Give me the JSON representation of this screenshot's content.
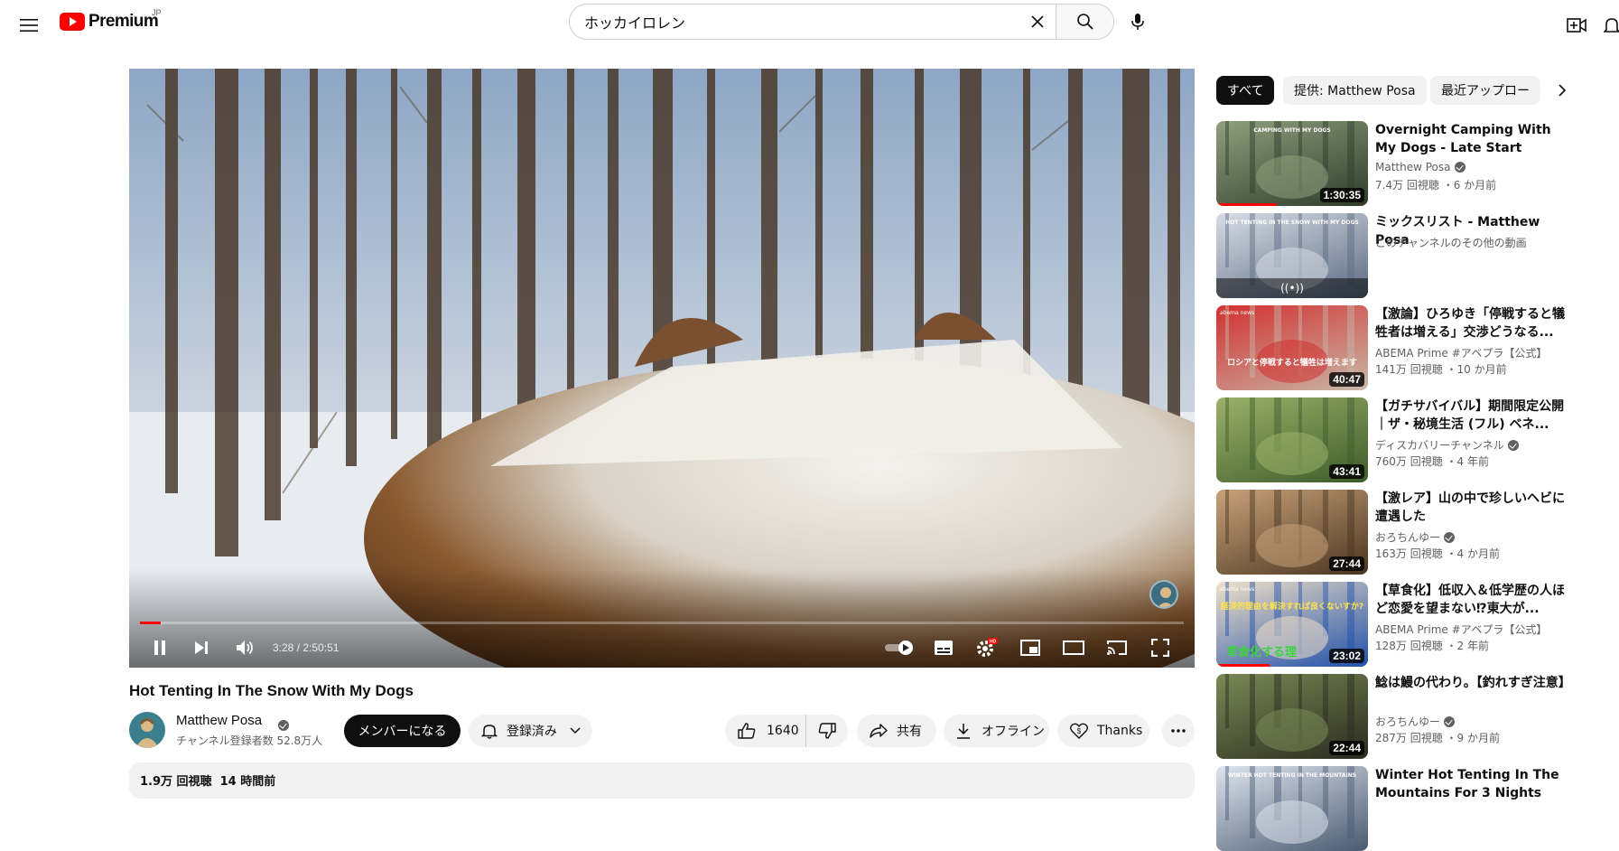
{
  "header": {
    "logo_text": "Premium",
    "region": "JP",
    "search_value": "ホッカイロレン"
  },
  "player": {
    "time_current": "3:28",
    "time_separator": " / ",
    "time_total": "2:50:51",
    "progress_played": 0.02,
    "progress_loaded": 0.021,
    "hd_badge": "HD"
  },
  "video": {
    "title": "Hot Tenting In The Snow With My Dogs",
    "channel": "Matthew Posa",
    "subscribers": "チャンネル登録者数 52.8万人",
    "join_label": "メンバーになる",
    "subscribed_label": "登録済み",
    "likes": "1640",
    "share_label": "共有",
    "offline_label": "オフライン",
    "thanks_label": "Thanks",
    "views_and_date": "1.9万 回視聴  14 時間前"
  },
  "sidebar": {
    "chips": [
      "すべて",
      "提供: Matthew Posa",
      "最近アップロー"
    ],
    "recommendations": [
      {
        "title": "Overnight Camping With My Dogs - Late Start Enabled",
        "channel": "Matthew Posa",
        "verified": true,
        "meta": "7.4万 回視聴 ・6 か月前",
        "duration": "1:30:35",
        "watched": 0.4,
        "thumb_text": "CAMPING WITH MY DOGS",
        "colors": [
          "#2f3b2a",
          "#8fa07e"
        ]
      },
      {
        "title": "ミックスリスト - Matthew Posa",
        "channel": "このチャンネルのその他の動画",
        "verified": false,
        "meta": "",
        "duration": "",
        "watched": 0,
        "thumb_text": "HOT TENTING IN THE SNOW WITH MY DOGS",
        "mix_symbol": "((•))",
        "colors": [
          "#5a6a80",
          "#d8dde6"
        ]
      },
      {
        "title": "【激論】ひろゆき「停戦すると犠牲者は増える」交渉どうなる...",
        "channel": "ABEMA Prime #アベプラ【公式】",
        "verified": false,
        "meta": "141万 回視聴 ・10 か月前",
        "duration": "40:47",
        "watched": 0,
        "thumb_text": "ロシアと停戦すると犠牲は増えます",
        "thumb_label": "abema news",
        "colors": [
          "#c8b8a8",
          "#d23030"
        ]
      },
      {
        "title": "【ガチサバイバル】期間限定公開｜ザ・秘境生活 (フル) ベネ...",
        "channel": "ディスカバリーチャンネル",
        "verified": true,
        "meta": "760万 回視聴 ・4 年前",
        "duration": "43:41",
        "watched": 0,
        "colors": [
          "#3d5a2a",
          "#9bb26a"
        ]
      },
      {
        "title": "【激レア】山の中で珍しいヘビに遭遇した",
        "channel": "おろちんゆー",
        "verified": true,
        "meta": "163万 回視聴 ・4 か月前",
        "duration": "27:44",
        "watched": 0,
        "colors": [
          "#4a3520",
          "#c8a27a"
        ]
      },
      {
        "title": "【草食化】低収入＆低学歴の人ほど恋愛を望まない⁉東大が...",
        "channel": "ABEMA Prime #アベプラ【公式】",
        "verified": false,
        "meta": "128万 回視聴 ・2 年前",
        "duration": "23:02",
        "watched": 0.35,
        "thumb_text": "経済的理由を解決すれば良くないすか?",
        "thumb_label": "abema news",
        "thumb_text2": "草食化する理",
        "colors": [
          "#1f4fa8",
          "#f0e0c8"
        ]
      },
      {
        "title": "鯰は鰻の代わり。【釣れすぎ注意】",
        "channel": "おろちんゆー",
        "verified": true,
        "meta": "287万 回視聴 ・9 か月前",
        "duration": "22:44",
        "watched": 0,
        "colors": [
          "#2a2a1f",
          "#7a8a55"
        ]
      },
      {
        "title": "Winter Hot Tenting In The Mountains For 3 Nights",
        "channel": "",
        "verified": false,
        "meta": "",
        "duration": "",
        "watched": 0,
        "thumb_text": "WINTER HOT TENTING IN THE MOUNTAINS",
        "colors": [
          "#4a5a70",
          "#dde4ee"
        ]
      }
    ]
  }
}
